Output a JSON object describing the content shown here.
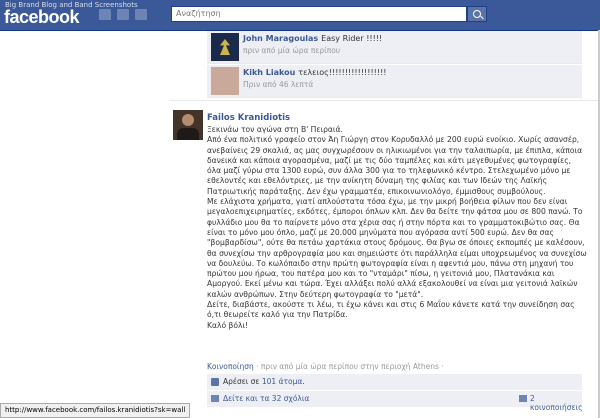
{
  "caption": "Big Brand Blog and Band Screenshots",
  "logo": "facebook",
  "search": {
    "placeholder": "Αναζήτηση"
  },
  "comments": [
    {
      "name": "John Maragoulas",
      "text": "Easy Rider !!!!!",
      "time": "πριν από μία ώρα περίπου"
    },
    {
      "name": "Kikh Liakou",
      "text": "τελειος!!!!!!!!!!!!!!!!!!",
      "time": "Πριν από 46 λεπτά"
    }
  ],
  "post": {
    "author": "Failos Kranidiotis",
    "paragraphs": [
      "Ξεκινάω τον αγώνα στη Β' Πειραιά.",
      "Από ένα πολιτικό γραφείο στον Άη Γιώργη στον Κορυδαλλό με 200 ευρώ ενοίκιο. Χωρίς ασανσέρ, ανεβαίνεις 29 σκαλιά, ας μας συγχωρέσουν οι ηλικιωμένοι για την ταλαιπωρία, με έπιπλα, κάποια δανεικά και κάποια αγορασμένα, μαζί με τις δύο ταμπέλες και κάτι μεγεθυμένες φωτογραφίες, όλα μαζί γύρω στα 1300 ευρώ, συν άλλα 300 για το τηλεφωνικό κέντρο. Στελεχωμένο μόνο με εθελοντές και εθελόντριες, με την ανίκητη δύναμη της φιλίας και των Ιδεών της Λαϊκής Πατριωτικής παράταξης. Δεν έχω γραμματέα, επικοινωνιολόγο, έμμισθους συμβούλους.",
      "Με ελάχιστα χρήματα, γιατί απλούστατα τόσα έχω, με την μικρή βοήθεια φίλων που δεν είναι μεγαλοεπιχειρηματίες, εκδότες, έμποροι όπλων κλπ. Δεν θα δείτε την φάτσα μου σε 800 πανώ. Το φυλλάδιο μου θα το παίρνετε μόνο στα χέρια σας ή στην πόρτα και το γραμματοκιβώτιο σας. Θα είναι το μόνο μου όπλο, μαζί με 20.000 μηνύματα που αγόρασα αντί 500 ευρώ. Δεν θα σας \"βομβαρδίσω\", ούτε θα πετάω χαρτάκια στους δρόμους. Θα βγω σε όποιες εκπομπές με καλέσουν, θα συνεχίσω την αρθρογραφία μου και σημειώστε ότι παράλληλα είμαι υποχρεωμένος να συνεχίσω να δουλεύω. Το κωλόπαιδο στην πρώτη φωτογραφία είναι η αφεντιά μου, πάνω στη μηχανή του πρώτου μου ήρωα, του πατέρα μου και το \"νταμάρι\" πίσω, η γειτονιά μου, Πλατανάκια και Αμοργού. Εκεί μένω και τώρα. Έχει αλλάξει πολύ αλλά εξακολουθεί να είναι μια γειτονιά λαϊκών καλών ανθρώπων. Στην δεύτερη φωτογραφία το \"μετά\".",
      "Δείτε, διαβάστε, ακούστε τι λέω, τι έχω κάνει και στις 6 Μαΐου κάνετε κατά την συνείδηση σας ό,τι θεωρείτε καλό για την Πατρίδα.",
      "Καλό βόλι!"
    ],
    "meta_link": "Κοινοποίηση",
    "meta_text": " · πριν από μία ώρα περίπου στην περιοχή Athens · "
  },
  "likes": {
    "prefix": "Αρέσει σε ",
    "link": "101 άτομα",
    "suffix": "."
  },
  "comments_bar": {
    "view": "Δείτε και τα 32 σχόλια",
    "shares": "2 κοινοποιήσεις"
  },
  "status_url": "http://www.facebook.com/failos.kranidiotis?sk=wall"
}
